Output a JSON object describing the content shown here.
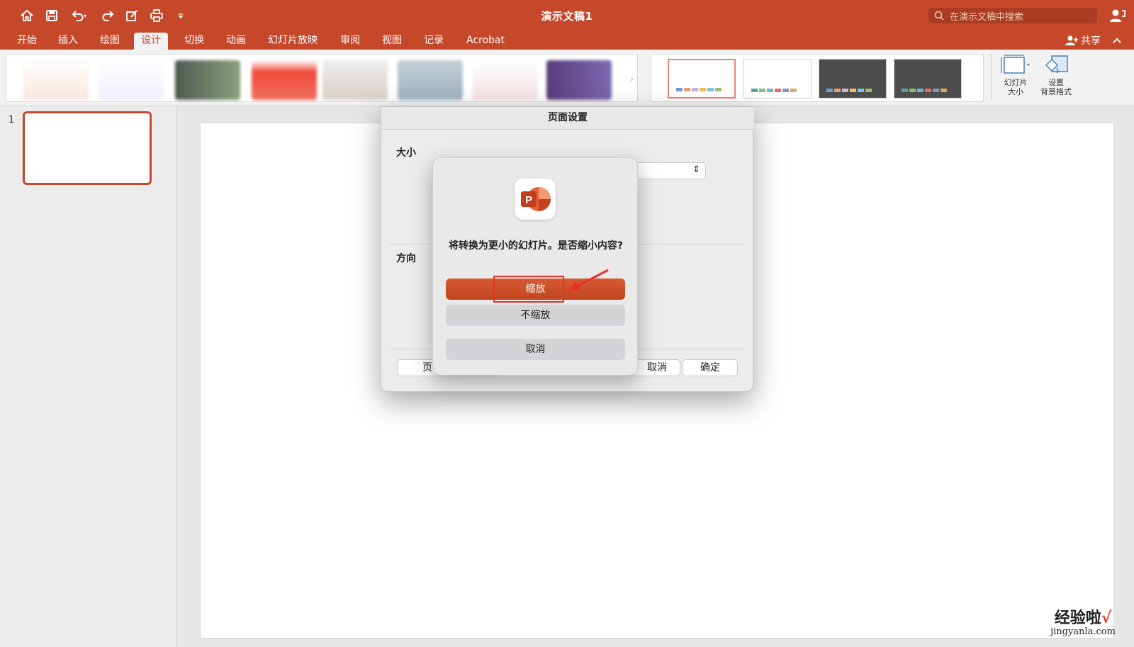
{
  "window": {
    "title": "演示文稿1",
    "search_placeholder": "在演示文稿中搜索"
  },
  "quick_access": {
    "icons": [
      "home-icon",
      "save-icon",
      "undo-icon",
      "redo-icon",
      "edit-icon",
      "print-icon",
      "customize-icon"
    ]
  },
  "menu": {
    "tabs": [
      "开始",
      "插入",
      "绘图",
      "设计",
      "切换",
      "动画",
      "幻灯片放映",
      "审阅",
      "视图",
      "记录",
      "Acrobat"
    ],
    "active_tab": "设计",
    "share_label": "共享"
  },
  "ribbon": {
    "slide_size_label_1": "幻灯片",
    "slide_size_label_2": "大小",
    "bg_format_label_1": "设置",
    "bg_format_label_2": "背景格式"
  },
  "slides_pane": {
    "slide_number": "1"
  },
  "page_setup": {
    "title": "页面设置",
    "size_label": "大小",
    "orientation_label": "方向",
    "options_button": "页",
    "cancel_button": "取消",
    "ok_button": "确定"
  },
  "alert": {
    "message": "将转换为更小的幻灯片。是否缩小内容?",
    "scale_button": "缩放",
    "no_scale_button": "不缩放",
    "cancel_button": "取消"
  },
  "watermark": {
    "text": "经验啦",
    "check": "√",
    "url": "jingyanla.com"
  },
  "colors": {
    "brand": "#c6482a",
    "annotation": "#e5332a"
  }
}
